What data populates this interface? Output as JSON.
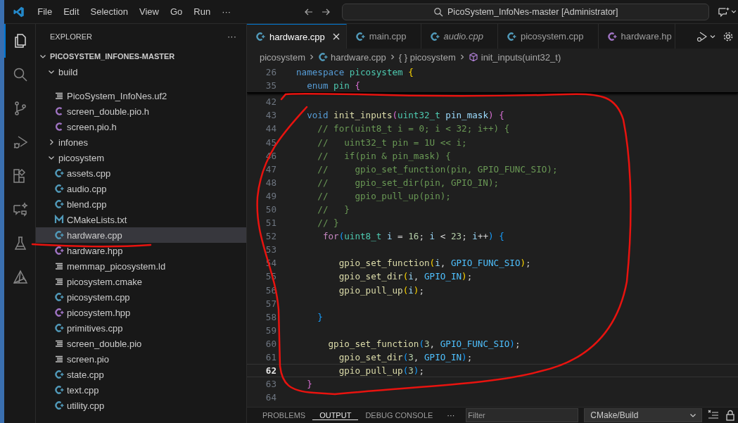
{
  "title_bar": {
    "menus": [
      "File",
      "Edit",
      "Selection",
      "View",
      "Go",
      "Run",
      "···"
    ],
    "search": {
      "value": "PicoSystem_InfoNes-master [Administrator]"
    }
  },
  "activity_bar": {
    "items": [
      {
        "kind": "files",
        "selected": true
      },
      {
        "kind": "search",
        "selected": false
      },
      {
        "kind": "source-control",
        "selected": false
      },
      {
        "kind": "run-debug",
        "selected": false
      },
      {
        "kind": "extensions",
        "selected": false
      },
      {
        "kind": "chat",
        "selected": false
      },
      {
        "kind": "testing",
        "selected": false
      },
      {
        "kind": "cmake",
        "selected": false
      }
    ]
  },
  "explorer": {
    "title": "EXPLORER",
    "more": "···",
    "project": {
      "name": "PICOSYSTEM_INFONES-MASTER",
      "expanded": true,
      "children": [
        {
          "name": "build",
          "kind": "folder",
          "expanded": true,
          "children": [
            {
              "name": "PicoSystem_InfoNes.uf2",
              "kind": "text",
              "selected": false
            },
            {
              "name": "screen_double.pio.h",
              "kind": "c",
              "selected": false
            },
            {
              "name": "screen.pio.h",
              "kind": "c",
              "selected": false
            }
          ]
        },
        {
          "name": "infones",
          "kind": "folder",
          "expanded": false
        },
        {
          "name": "picosystem",
          "kind": "folder",
          "expanded": true,
          "children": [
            {
              "name": "assets.cpp",
              "kind": "cpp",
              "selected": false
            },
            {
              "name": "audio.cpp",
              "kind": "cpp",
              "selected": false
            },
            {
              "name": "blend.cpp",
              "kind": "cpp",
              "selected": false
            },
            {
              "name": "CMakeLists.txt",
              "kind": "cmake",
              "selected": false
            },
            {
              "name": "hardware.cpp",
              "kind": "cpp",
              "selected": true
            },
            {
              "name": "hardware.hpp",
              "kind": "hpp",
              "selected": false
            },
            {
              "name": "memmap_picosystem.ld",
              "kind": "text",
              "selected": false
            },
            {
              "name": "picosystem.cmake",
              "kind": "text",
              "selected": false
            },
            {
              "name": "picosystem.cpp",
              "kind": "cpp",
              "selected": false
            },
            {
              "name": "picosystem.hpp",
              "kind": "hpp",
              "selected": false
            },
            {
              "name": "primitives.cpp",
              "kind": "cpp",
              "selected": false
            },
            {
              "name": "screen_double.pio",
              "kind": "text",
              "selected": false
            },
            {
              "name": "screen.pio",
              "kind": "text",
              "selected": false
            },
            {
              "name": "state.cpp",
              "kind": "cpp",
              "selected": false
            },
            {
              "name": "text.cpp",
              "kind": "cpp",
              "selected": false
            },
            {
              "name": "utility.cpp",
              "kind": "cpp",
              "selected": false
            }
          ]
        }
      ]
    }
  },
  "editor": {
    "tabs": [
      {
        "label": "hardware.cpp",
        "kind": "cpp",
        "selected": true,
        "preview": false
      },
      {
        "label": "main.cpp",
        "kind": "cpp",
        "selected": false,
        "preview": false
      },
      {
        "label": "audio.cpp",
        "kind": "cpp",
        "selected": false,
        "preview": true
      },
      {
        "label": "picosystem.cpp",
        "kind": "cpp",
        "selected": false,
        "preview": false
      },
      {
        "label": "hardware.hp",
        "kind": "hpp",
        "selected": false,
        "preview": false
      }
    ],
    "breadcrumb": [
      {
        "label": "picosystem",
        "kind": "folder"
      },
      {
        "label": "hardware.cpp",
        "kind": "cpp"
      },
      {
        "label": "{ } picosystem",
        "kind": "namespace"
      },
      {
        "label": "init_inputs(uint32_t)",
        "kind": "method"
      }
    ],
    "sticky_lines": [
      {
        "number": "26",
        "tokens": [
          {
            "text": "namespace",
            "kind": "keyword"
          },
          {
            "text": " picosystem ",
            "kind": "type"
          },
          {
            "text": "{",
            "kind": "gold"
          }
        ]
      },
      {
        "number": "35",
        "tokens": [
          {
            "text": "  enum",
            "kind": "keyword"
          },
          {
            "text": " pin ",
            "kind": "type"
          },
          {
            "text": "{",
            "kind": "pink"
          }
        ]
      }
    ],
    "lines": [
      {
        "number": "42",
        "current": false
      },
      {
        "number": "43",
        "current": false,
        "tokens": [
          {
            "text": "  void",
            "kind": "keyword"
          },
          {
            "text": " init_inputs",
            "kind": "func"
          },
          {
            "text": "(",
            "kind": "pink"
          },
          {
            "text": "uint32_t",
            "kind": "type"
          },
          {
            "text": " pin_mask",
            "kind": "var"
          },
          {
            "text": ")",
            "kind": "pink"
          },
          {
            "text": " {",
            "kind": "pink"
          }
        ]
      },
      {
        "number": "44",
        "current": false,
        "tokens": [
          {
            "text": "    // for(uint8_t i = 0; i < 32; i++) {",
            "kind": "comment"
          }
        ]
      },
      {
        "number": "45",
        "current": false,
        "tokens": [
          {
            "text": "    //   uint32_t pin = 1U << i;",
            "kind": "comment"
          }
        ]
      },
      {
        "number": "46",
        "current": false,
        "tokens": [
          {
            "text": "    //   if(pin & pin_mask) {",
            "kind": "comment"
          }
        ]
      },
      {
        "number": "47",
        "current": false,
        "tokens": [
          {
            "text": "    //     gpio_set_function(pin, GPIO_FUNC_SIO);",
            "kind": "comment"
          }
        ]
      },
      {
        "number": "48",
        "current": false,
        "tokens": [
          {
            "text": "    //     gpio_set_dir(pin, GPIO_IN);",
            "kind": "comment"
          }
        ]
      },
      {
        "number": "49",
        "current": false,
        "tokens": [
          {
            "text": "    //     gpio_pull_up(pin);",
            "kind": "comment"
          }
        ]
      },
      {
        "number": "50",
        "current": false,
        "tokens": [
          {
            "text": "    //   }",
            "kind": "comment"
          }
        ]
      },
      {
        "number": "51",
        "current": false,
        "tokens": [
          {
            "text": "    // }",
            "kind": "comment"
          }
        ]
      },
      {
        "number": "52",
        "current": false,
        "tokens": [
          {
            "text": "     for",
            "kind": "control"
          },
          {
            "text": "(",
            "kind": "blue"
          },
          {
            "text": "uint8_t",
            "kind": "type"
          },
          {
            "text": " i",
            "kind": "var"
          },
          {
            "text": " = ",
            "kind": "plain"
          },
          {
            "text": "16",
            "kind": "num"
          },
          {
            "text": "; ",
            "kind": "plain"
          },
          {
            "text": "i",
            "kind": "var"
          },
          {
            "text": " < ",
            "kind": "plain"
          },
          {
            "text": "23",
            "kind": "num"
          },
          {
            "text": "; ",
            "kind": "plain"
          },
          {
            "text": "i",
            "kind": "var"
          },
          {
            "text": "++",
            "kind": "plain"
          },
          {
            "text": ")",
            "kind": "blue"
          },
          {
            "text": " {",
            "kind": "blue"
          }
        ]
      },
      {
        "number": "53",
        "current": false
      },
      {
        "number": "54",
        "current": false,
        "tokens": [
          {
            "text": "        gpio_set_function",
            "kind": "func"
          },
          {
            "text": "(",
            "kind": "gold"
          },
          {
            "text": "i",
            "kind": "var"
          },
          {
            "text": ", ",
            "kind": "plain"
          },
          {
            "text": "GPIO_FUNC_SIO",
            "kind": "const"
          },
          {
            "text": ")",
            "kind": "gold"
          },
          {
            "text": ";",
            "kind": "plain"
          }
        ]
      },
      {
        "number": "55",
        "current": false,
        "tokens": [
          {
            "text": "        gpio_set_dir",
            "kind": "func"
          },
          {
            "text": "(",
            "kind": "gold"
          },
          {
            "text": "i",
            "kind": "var"
          },
          {
            "text": ", ",
            "kind": "plain"
          },
          {
            "text": "GPIO_IN",
            "kind": "const"
          },
          {
            "text": ")",
            "kind": "gold"
          },
          {
            "text": ";",
            "kind": "plain"
          }
        ]
      },
      {
        "number": "56",
        "current": false,
        "tokens": [
          {
            "text": "        gpio_pull_up",
            "kind": "func"
          },
          {
            "text": "(",
            "kind": "gold"
          },
          {
            "text": "i",
            "kind": "var"
          },
          {
            "text": ")",
            "kind": "gold"
          },
          {
            "text": ";",
            "kind": "plain"
          }
        ]
      },
      {
        "number": "57",
        "current": false
      },
      {
        "number": "58",
        "current": false,
        "tokens": [
          {
            "text": "    }",
            "kind": "blue"
          }
        ]
      },
      {
        "number": "59",
        "current": false
      },
      {
        "number": "60",
        "current": false,
        "tokens": [
          {
            "text": "      gpio_set_function",
            "kind": "func"
          },
          {
            "text": "(",
            "kind": "blue"
          },
          {
            "text": "3",
            "kind": "num"
          },
          {
            "text": ", ",
            "kind": "plain"
          },
          {
            "text": "GPIO_FUNC_SIO",
            "kind": "const"
          },
          {
            "text": ")",
            "kind": "blue"
          },
          {
            "text": ";",
            "kind": "plain"
          }
        ]
      },
      {
        "number": "61",
        "current": false,
        "tokens": [
          {
            "text": "        gpio_set_dir",
            "kind": "func"
          },
          {
            "text": "(",
            "kind": "blue"
          },
          {
            "text": "3",
            "kind": "num"
          },
          {
            "text": ", ",
            "kind": "plain"
          },
          {
            "text": "GPIO_IN",
            "kind": "const"
          },
          {
            "text": ")",
            "kind": "blue"
          },
          {
            "text": ";",
            "kind": "plain"
          }
        ]
      },
      {
        "number": "62",
        "current": true,
        "tokens": [
          {
            "text": "        gpio_pull_up",
            "kind": "func"
          },
          {
            "text": "(",
            "kind": "blue"
          },
          {
            "text": "3",
            "kind": "num"
          },
          {
            "text": ")",
            "kind": "blue"
          },
          {
            "text": ";",
            "kind": "plain"
          }
        ]
      },
      {
        "number": "63",
        "current": false,
        "tokens": [
          {
            "text": "  }",
            "kind": "pink"
          }
        ]
      },
      {
        "number": "64",
        "current": false
      }
    ]
  },
  "panel": {
    "tabs": [
      {
        "label": "PROBLEMS",
        "selected": false
      },
      {
        "label": "OUTPUT",
        "selected": true
      },
      {
        "label": "DEBUG CONSOLE",
        "selected": false
      }
    ],
    "more": "···",
    "filter": {
      "placeholder": "Filter"
    },
    "channel": {
      "value": "CMake/Build"
    }
  }
}
